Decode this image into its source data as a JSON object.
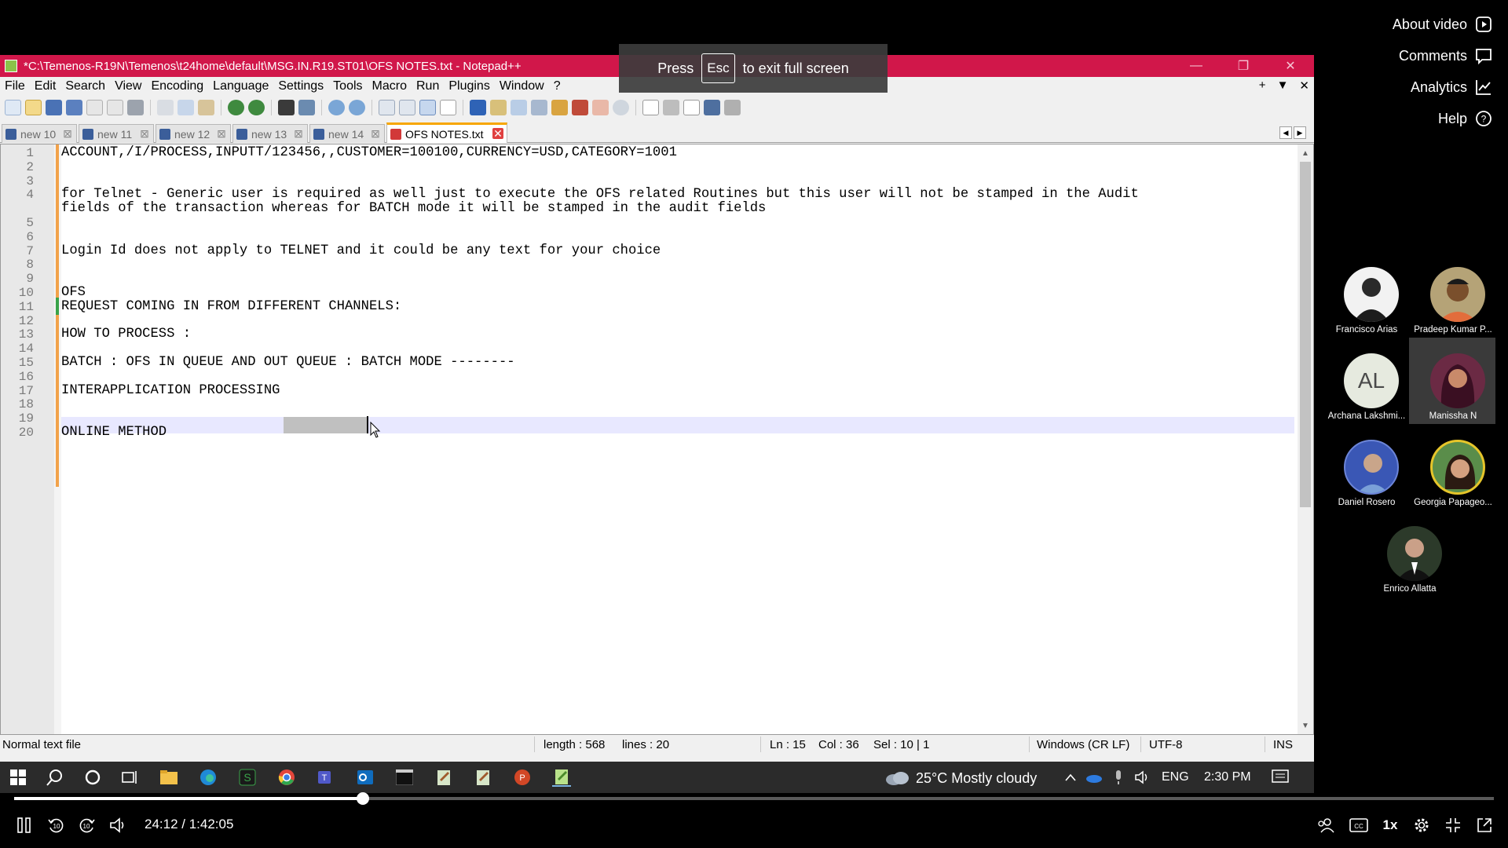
{
  "window": {
    "title": "*C:\\Temenos-R19N\\Temenos\\t24home\\default\\MSG.IN.R19.ST01\\OFS NOTES.txt - Notepad++",
    "controls": [
      "—",
      "❐",
      "✕"
    ]
  },
  "menubar": {
    "items": [
      "File",
      "Edit",
      "Search",
      "View",
      "Encoding",
      "Language",
      "Settings",
      "Tools",
      "Macro",
      "Run",
      "Plugins",
      "Window",
      "?"
    ],
    "right": [
      "+",
      "▼",
      "✕"
    ]
  },
  "tabs": [
    {
      "label": "new 10",
      "active": false
    },
    {
      "label": "new 11",
      "active": false
    },
    {
      "label": "new 12",
      "active": false
    },
    {
      "label": "new 13",
      "active": false
    },
    {
      "label": "new 14",
      "active": false
    },
    {
      "label": "OFS NOTES.txt",
      "active": true
    }
  ],
  "editor": {
    "lines": [
      {
        "n": "1",
        "text": "ACCOUNT,/I/PROCESS,INPUTT/123456,,CUSTOMER=100100,CURRENCY=USD,CATEGORY=1001"
      },
      {
        "n": "2",
        "text": ""
      },
      {
        "n": "3",
        "text": ""
      },
      {
        "n": "4",
        "text": "for Telnet - Generic user is required as well just to execute the OFS related Routines but this user will not be stamped in the Audit"
      },
      {
        "n": "",
        "text": "fields of the transaction whereas for BATCH mode it will be stamped in the audit fields"
      },
      {
        "n": "5",
        "text": ""
      },
      {
        "n": "6",
        "text": ""
      },
      {
        "n": "7",
        "text": "Login Id does not apply to TELNET and it could be any text for your choice"
      },
      {
        "n": "8",
        "text": ""
      },
      {
        "n": "9",
        "text": ""
      },
      {
        "n": "10",
        "text": "OFS"
      },
      {
        "n": "11",
        "text": "REQUEST COMING IN FROM DIFFERENT CHANNELS:"
      },
      {
        "n": "12",
        "text": ""
      },
      {
        "n": "13",
        "text": "HOW TO PROCESS :"
      },
      {
        "n": "14",
        "text": ""
      },
      {
        "n": "15",
        "text": "BATCH : OFS IN QUEUE AND OUT QUEUE : BATCH MODE --------"
      },
      {
        "n": "16",
        "text": ""
      },
      {
        "n": "17",
        "text": "INTERAPPLICATION PROCESSING"
      },
      {
        "n": "18",
        "text": ""
      },
      {
        "n": "19",
        "text": ""
      },
      {
        "n": "20",
        "text": "ONLINE METHOD"
      }
    ]
  },
  "statusbar": {
    "filetype": "Normal text file",
    "length": "length : 568",
    "lines": "lines : 20",
    "ln": "Ln : 15",
    "col": "Col : 36",
    "sel": "Sel : 10 | 1",
    "eol": "Windows (CR LF)",
    "encoding": "UTF-8",
    "mode": "INS"
  },
  "taskbar": {
    "weather": "25°C  Mostly cloudy",
    "lang": "ENG",
    "time": "2:30 PM"
  },
  "fullscreen_toast": {
    "press": "Press",
    "key": "Esc",
    "message": "to exit full screen"
  },
  "side_menu": {
    "about": "About video",
    "comments": "Comments",
    "analytics": "Analytics",
    "help": "Help"
  },
  "participants": [
    {
      "name": "Francisco Arias",
      "initials": ""
    },
    {
      "name": "Pradeep Kumar P...",
      "initials": ""
    },
    {
      "name": "Archana Lakshmi...",
      "initials": "AL"
    },
    {
      "name": "Manissha N",
      "initials": ""
    },
    {
      "name": "Daniel Rosero",
      "initials": ""
    },
    {
      "name": "Georgia Papageo...",
      "initials": ""
    },
    {
      "name": "Enrico Allatta",
      "initials": ""
    }
  ],
  "player": {
    "timecode": "24:12 / 1:42:05",
    "progress": 0.2358,
    "speed": "1x",
    "skip_back": "10",
    "skip_fwd": "10"
  },
  "colors": {
    "titlebar": "#d1174a",
    "active_tab_accent": "#f7a600",
    "change_bar": "#f2a24a",
    "current_line": "#e8e8ff"
  }
}
